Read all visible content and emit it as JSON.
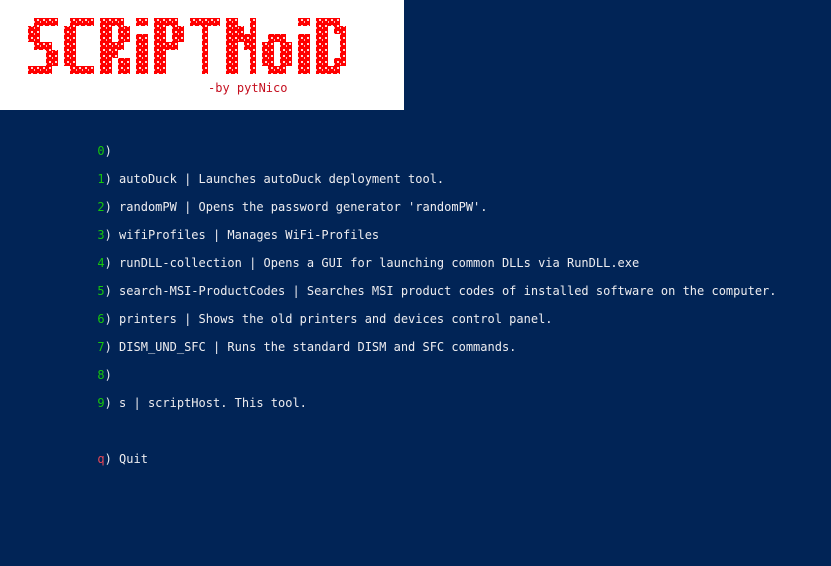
{
  "colors": {
    "background": "#012456",
    "foreground": "#eeedf0",
    "banner_background": "#ffffff",
    "logo_red": "#ff0000",
    "byline_color": "#c50f1f",
    "key_green": "#16c60c",
    "key_quit": "#e74856"
  },
  "banner": {
    "logo_text": "SCRIPTNoID",
    "byline": "-by pytNico"
  },
  "menu": {
    "items": [
      {
        "key": "0",
        "paren": ")",
        "text": ""
      },
      {
        "key": "1",
        "paren": ")",
        "text": " autoDuck | Launches autoDuck deployment tool."
      },
      {
        "key": "2",
        "paren": ")",
        "text": " randomPW | Opens the password generator 'randomPW'."
      },
      {
        "key": "3",
        "paren": ")",
        "text": " wifiProfiles | Manages WiFi-Profiles"
      },
      {
        "key": "4",
        "paren": ")",
        "text": " runDLL-collection | Opens a GUI for launching common DLLs via RunDLL.exe"
      },
      {
        "key": "5",
        "paren": ")",
        "text": " search-MSI-ProductCodes | Searches MSI product codes of installed software on the computer."
      },
      {
        "key": "6",
        "paren": ")",
        "text": " printers | Shows the old printers and devices control panel."
      },
      {
        "key": "7",
        "paren": ")",
        "text": " DISM_UND_SFC | Runs the standard DISM and SFC commands."
      },
      {
        "key": "8",
        "paren": ")",
        "text": ""
      },
      {
        "key": "9",
        "paren": ")",
        "text": " s | scriptHost. This tool."
      }
    ],
    "quit": {
      "key": "q",
      "paren": ")",
      "text": " Quit"
    }
  }
}
